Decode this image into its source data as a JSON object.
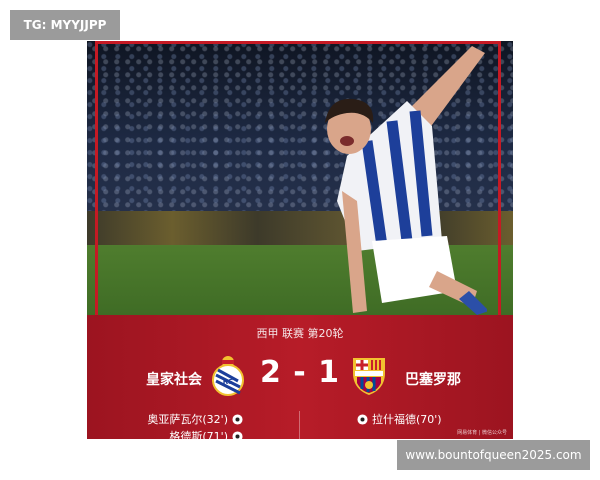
{
  "watermark_tag": "TG: MYYJJPP",
  "watermark_url": "www.bountofqueen2025.com",
  "match": {
    "competition": "西甲 联赛 第20轮",
    "home_team": "皇家社会",
    "away_team": "巴塞罗那",
    "home_score": "2",
    "separator": "-",
    "away_score": "1",
    "home_scorers": [
      "奥亚萨瓦尔(32')",
      "格德斯(71')"
    ],
    "away_scorers": [
      "拉什福德(70')"
    ],
    "home_crest_icon": "real-sociedad-crest-icon",
    "away_crest_icon": "fc-barcelona-crest-icon",
    "source_text": "网易体育 | 微信公众号"
  },
  "colors": {
    "panel_red": "#b71c28",
    "frame_red": "#c51a24",
    "watermark_gray": "#9b9b9b"
  }
}
